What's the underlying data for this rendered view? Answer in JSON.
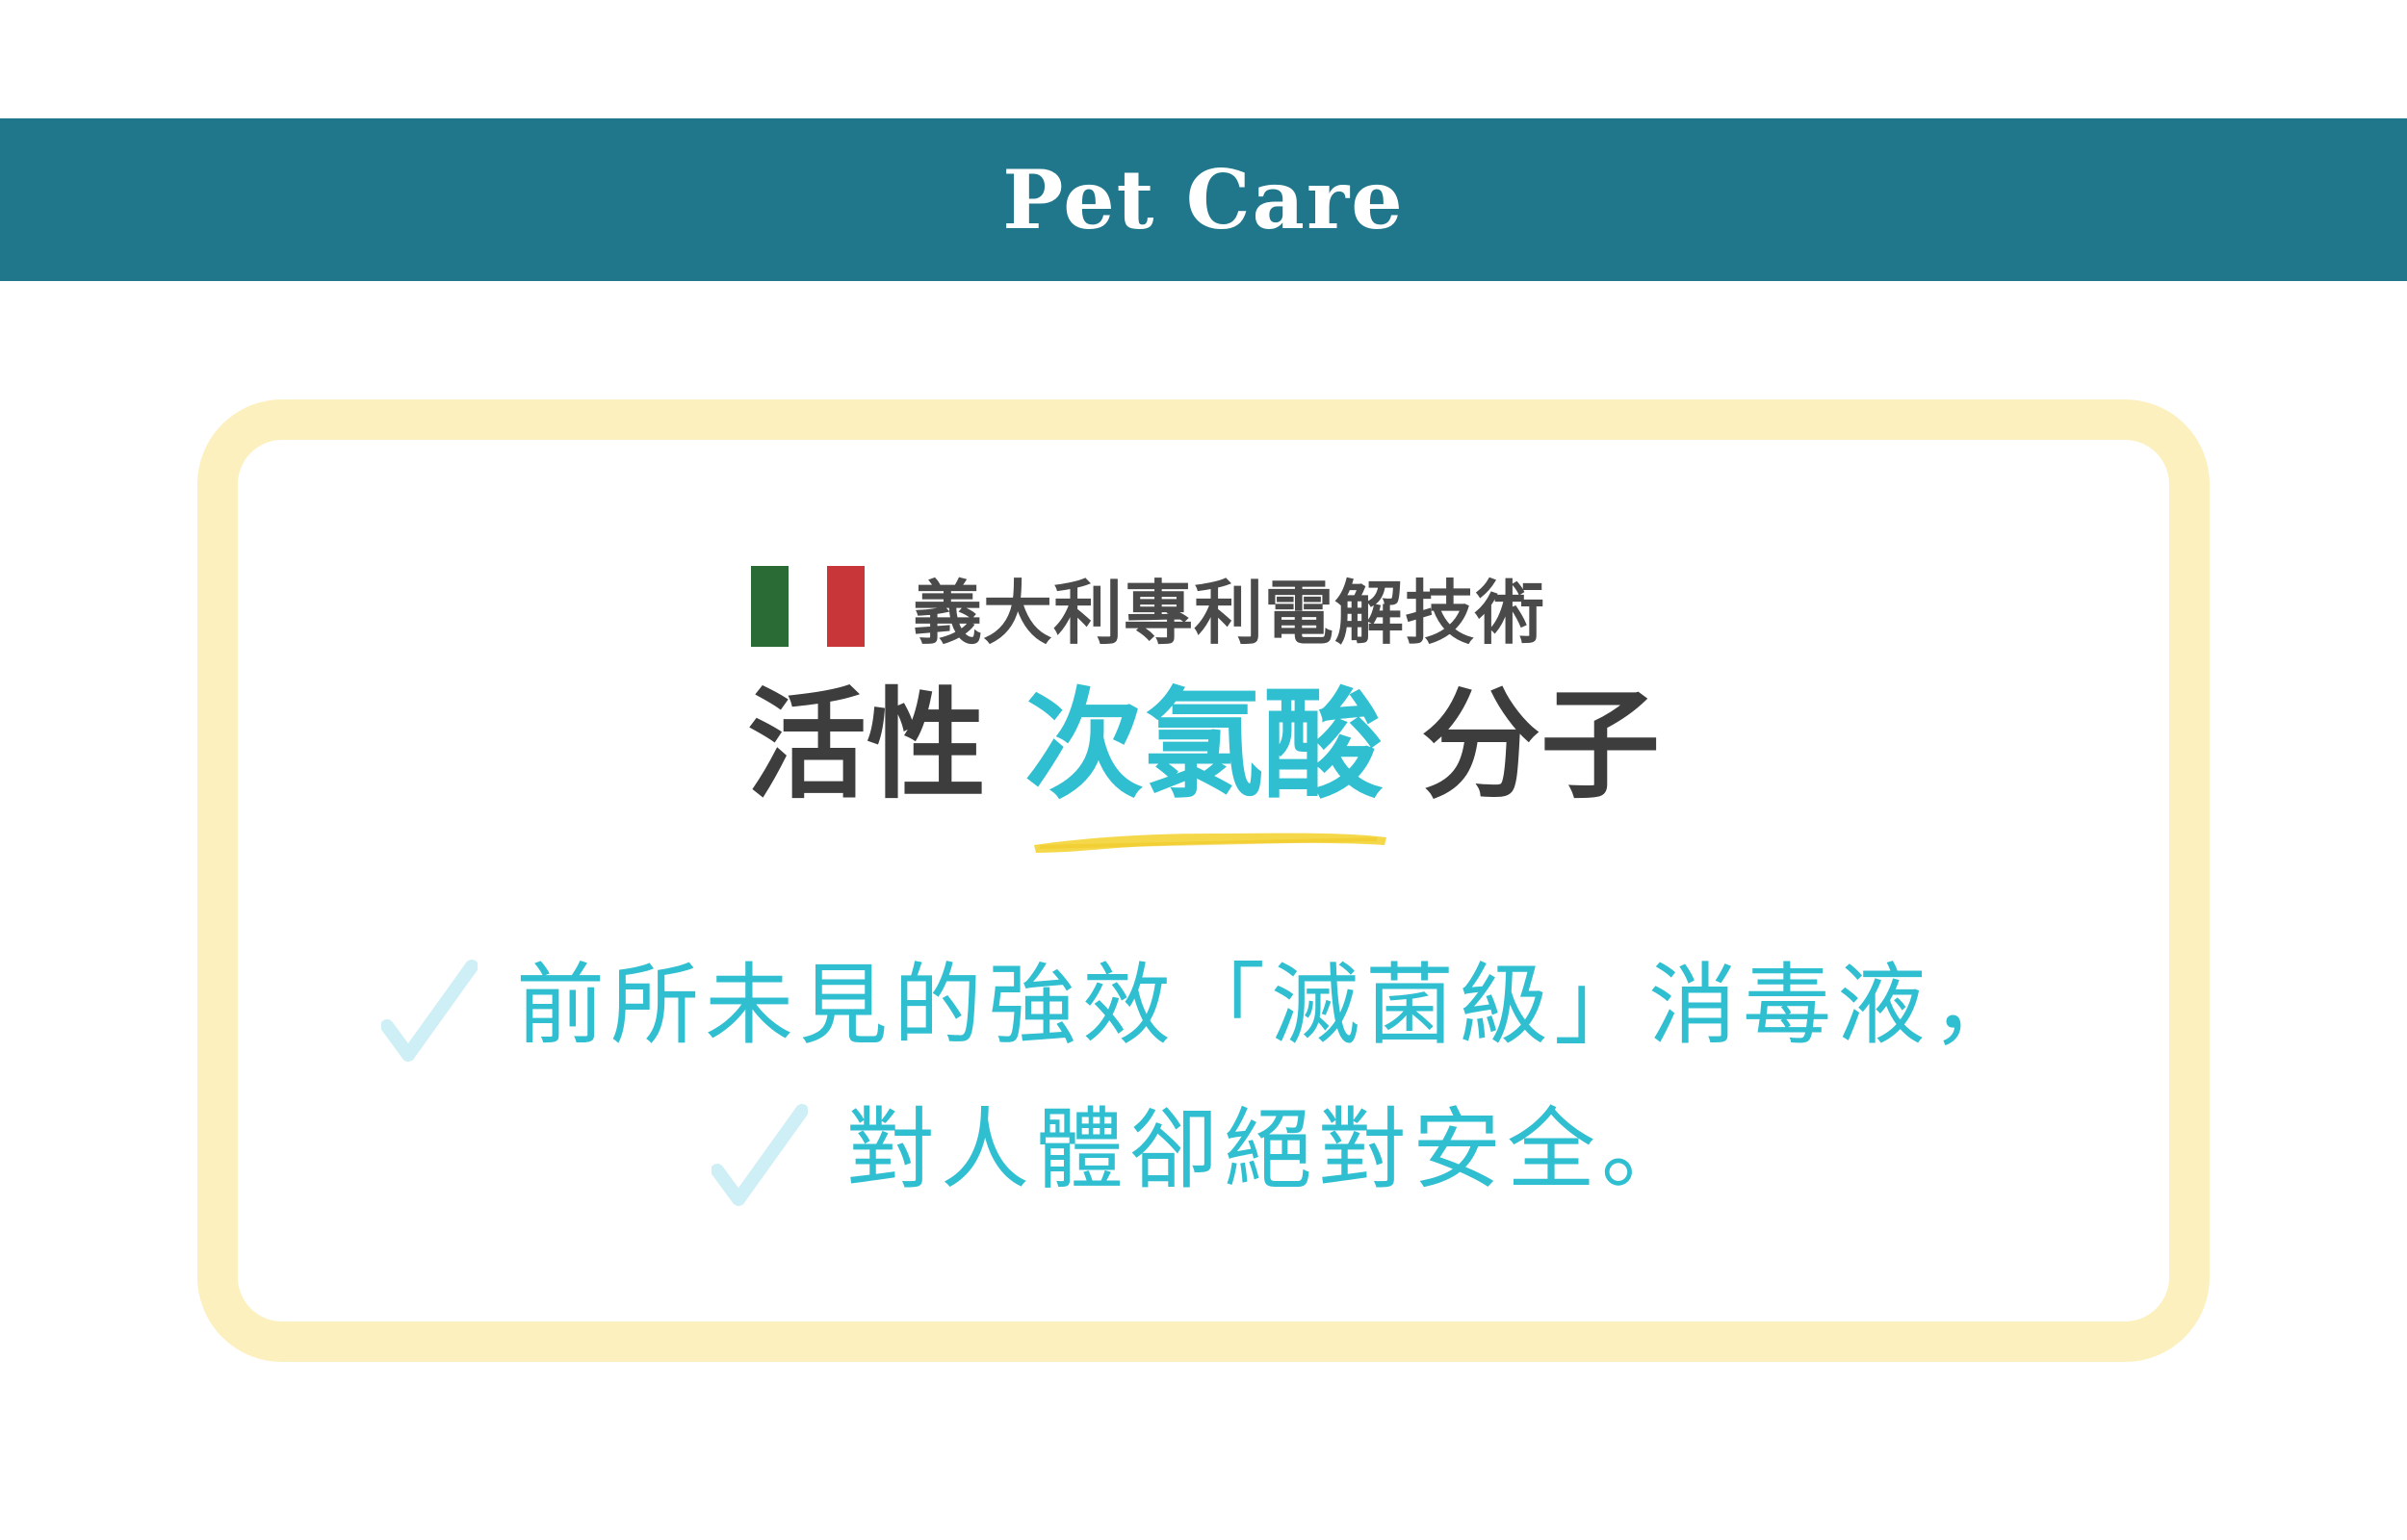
{
  "banner": {
    "title": "Pet Care",
    "color": "#20768a"
  },
  "card": {
    "border_color": "#fcf0bf"
  },
  "subtitle": {
    "flag_icon": "italy-flag-icon",
    "flag_colors": [
      "#2a6a35",
      "#ffffff",
      "#c9363a"
    ],
    "text": "義大利專利電解技術"
  },
  "headline": {
    "part1": "活性",
    "accent": "次氯酸",
    "part2": "分子",
    "accent_color": "#2fbfd0",
    "highlight_color": "#f4d53b"
  },
  "bullets": [
    {
      "icon": "checkmark-icon",
      "text": "前所未見的強效「滅菌級」消毒液，"
    },
    {
      "icon": "checkmark-icon",
      "text": "對人體卻絕對安全。"
    }
  ]
}
